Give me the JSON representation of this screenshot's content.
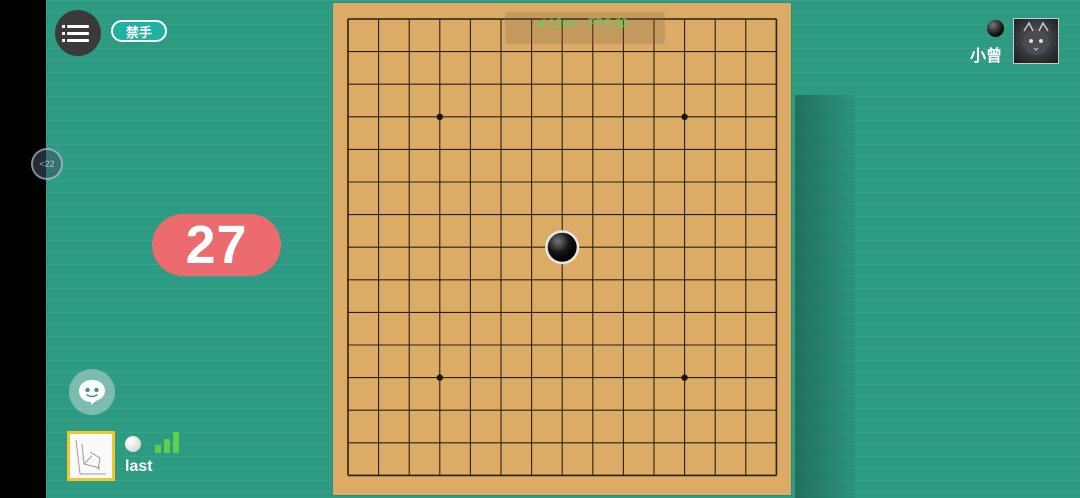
{
  "toolbar": {
    "menu_icon": "menu-icon",
    "forbidden_moves_label": "禁手"
  },
  "floating_ball_label": "<22",
  "debug": {
    "latency": "al 12ms",
    "fps": "FPS 60"
  },
  "timer": {
    "seconds": "27",
    "color": "#ec6b6f"
  },
  "board": {
    "size": 15,
    "star_points": [
      [
        3,
        3
      ],
      [
        11,
        3
      ],
      [
        7,
        7
      ],
      [
        3,
        11
      ],
      [
        11,
        11
      ]
    ],
    "stones": [
      {
        "col": 7,
        "row": 7,
        "color": "black"
      }
    ]
  },
  "opponent": {
    "name": "小曾",
    "stone": "black",
    "avatar_icon": "cat-avatar-icon"
  },
  "me": {
    "name": "last",
    "stone": "white",
    "signal_bars": 3,
    "avatar_icon": "sketch-avatar-icon"
  },
  "colors": {
    "table": "#2d9a82",
    "board": "#dcab66",
    "timer": "#ec6b6f",
    "accent": "#1fb2a2",
    "signal": "#5bd04a"
  }
}
